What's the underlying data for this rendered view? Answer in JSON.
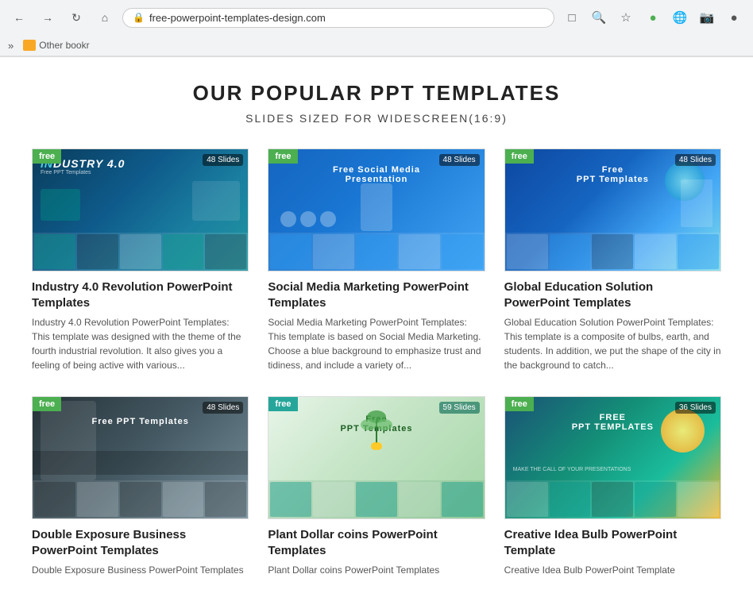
{
  "browser": {
    "url": "free-powerpoint-templates-design.com",
    "bookmarks_chevron": "»",
    "other_bookmarks": "Other bookr"
  },
  "page": {
    "title": "OUR POPULAR PPT TEMPLATES",
    "subtitle": "SLIDES SIZED FOR WIDESCREEN(16:9)"
  },
  "templates": [
    {
      "id": "industry",
      "title": "Industry 4.0 Revolution PowerPoint Templates",
      "description": "Industry 4.0 Revolution PowerPoint Templates: This template was designed with the theme of the fourth industrial revolution. It also gives you a feeling of being active with various...",
      "free_label": "free",
      "slides_count": "48 Slides",
      "thumb_type": "industry"
    },
    {
      "id": "social",
      "title": "Social Media Marketing PowerPoint Templates",
      "description": "Social Media Marketing PowerPoint Templates: This template is based on Social Media Marketing. Choose a blue background to emphasize trust and tidiness, and include a variety of...",
      "free_label": "free",
      "slides_count": "48 Slides",
      "thumb_type": "social"
    },
    {
      "id": "education",
      "title": "Global Education Solution PowerPoint Templates",
      "description": "Global Education Solution PowerPoint Templates: This template is a composite of bulbs, earth, and students. In addition, we put the shape of the city in the background to catch...",
      "free_label": "free",
      "slides_count": "48 Slides",
      "thumb_type": "education"
    },
    {
      "id": "double",
      "title": "Double Exposure Business PowerPoint Templates",
      "description": "Double Exposure Business PowerPoint Templates",
      "free_label": "free",
      "slides_count": "48 Slides",
      "thumb_type": "double"
    },
    {
      "id": "plant",
      "title": "Plant Dollar coins PowerPoint Templates",
      "description": "Plant Dollar coins PowerPoint Templates",
      "free_label": "free",
      "slides_count": "59 Slides",
      "thumb_type": "plant"
    },
    {
      "id": "bulb",
      "title": "Creative Idea Bulb PowerPoint Template",
      "description": "Creative Idea Bulb PowerPoint Template",
      "free_label": "free",
      "slides_count": "36 Slides",
      "thumb_type": "bulb"
    }
  ],
  "nav_icons": {
    "back": "←",
    "forward": "→",
    "refresh": "↻",
    "home": "⌂",
    "extensions": "⧉",
    "search": "🔍",
    "star": "☆",
    "download": "⬇",
    "menu": "⋮",
    "profile": "👤"
  }
}
